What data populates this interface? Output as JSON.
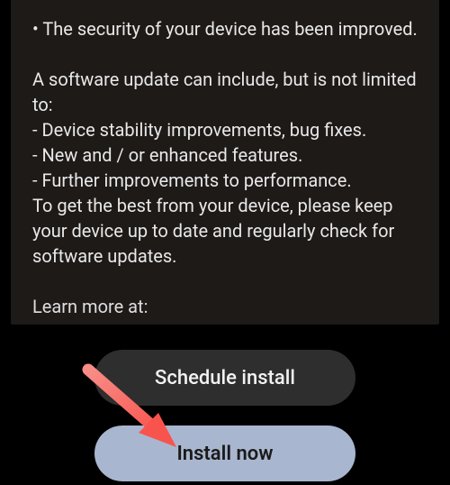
{
  "updateInfo": {
    "securityLine": "• The security of your device has been improved.",
    "leadIn": "A software update can include, but is not limited to:",
    "items": [
      " - Device stability improvements, bug fixes.",
      " - New and / or enhanced features.",
      " - Further improvements to performance."
    ],
    "afterList": "To get the best from your device, please keep your device up to date and regularly check for software updates.",
    "learnMore": "Learn more at:"
  },
  "buttons": {
    "schedule": "Schedule install",
    "install": "Install now"
  },
  "colors": {
    "cardBg": "#1e1a18",
    "pageBg": "#000000",
    "btnSecondaryBg": "#2e2e2e",
    "btnPrimaryBg": "#a9b6cf",
    "arrow": "#fa6a64"
  }
}
